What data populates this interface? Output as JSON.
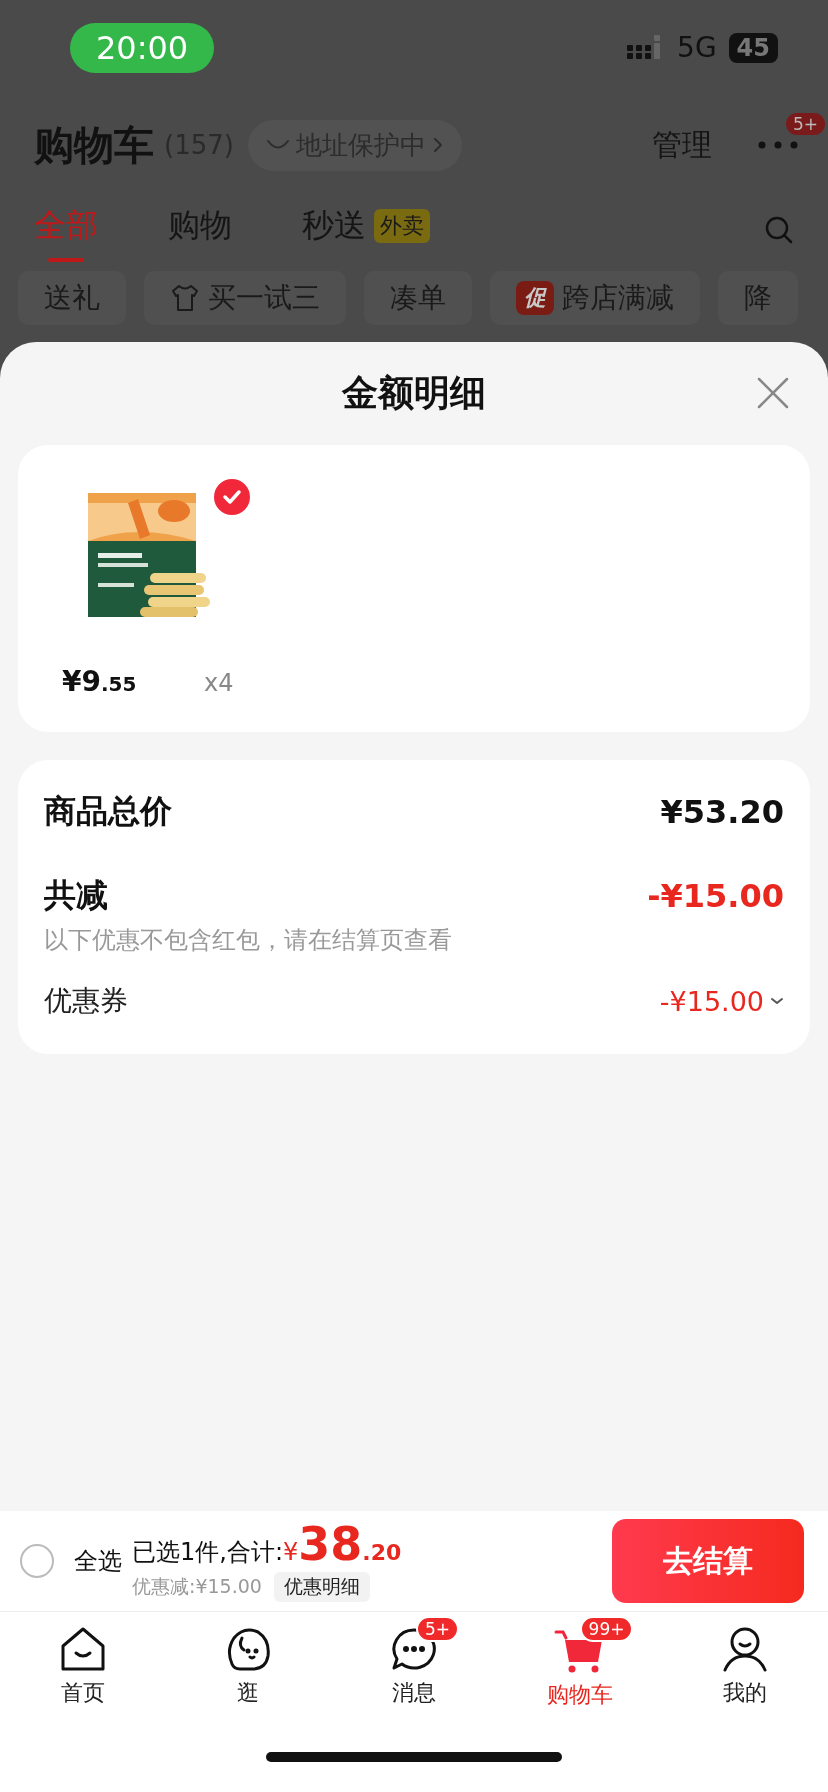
{
  "status_bar": {
    "time": "20:00",
    "network": "5G",
    "battery": "45"
  },
  "header": {
    "title": "购物车",
    "count": "(157)",
    "address_chip": "地址保护中",
    "manage": "管理",
    "more_badge": "5+"
  },
  "tabs": [
    {
      "label": "全部",
      "selected": true
    },
    {
      "label": "购物",
      "selected": false
    },
    {
      "label": "秒送",
      "selected": false,
      "badge": "外卖"
    }
  ],
  "chips": [
    {
      "kind": "plain",
      "label": "送礼"
    },
    {
      "kind": "shirt",
      "label": "买一试三"
    },
    {
      "kind": "plain",
      "label": "凑单"
    },
    {
      "kind": "promo",
      "tag": "促",
      "label": "跨店满减"
    },
    {
      "kind": "plain",
      "label": "降"
    }
  ],
  "sheet": {
    "title": "金额明细",
    "product": {
      "kind": "picture",
      "checked": true,
      "price_symbol": "¥",
      "price_int": "9",
      "price_dec": ".55",
      "quantity": "x4"
    },
    "summary": {
      "total_label": "商品总价",
      "total_value": "¥53.20",
      "reduce_label": "共减",
      "reduce_value": "-¥15.00",
      "note": "以下优惠不包含红包，请在结算页查看",
      "coupon_label": "优惠券",
      "coupon_value": "-¥15.00"
    }
  },
  "checkout_bar": {
    "select_all": {
      "label": "全选",
      "checked": false
    },
    "selected_text": "已选1件,合计:",
    "total_symbol": "¥",
    "total_int": "38",
    "total_dec": ".20",
    "discount_text": "优惠减:¥15.00",
    "detail_button": "优惠明细",
    "checkout_button": "去结算"
  },
  "nav": [
    {
      "kind": "home",
      "label": "首页",
      "selected": false
    },
    {
      "kind": "face",
      "label": "逛",
      "selected": false
    },
    {
      "kind": "message",
      "label": "消息",
      "selected": false,
      "badge": "5+"
    },
    {
      "kind": "cart",
      "label": "购物车",
      "selected": true,
      "badge": "99+"
    },
    {
      "kind": "person",
      "label": "我的",
      "selected": false
    }
  ]
}
